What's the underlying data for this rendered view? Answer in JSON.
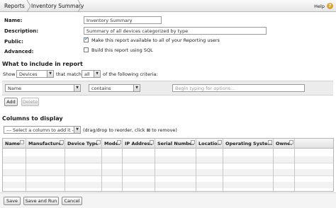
{
  "breadcrumb": {
    "root": "Reports",
    "current": "Inventory Summary"
  },
  "help": {
    "label": "Help"
  },
  "form": {
    "name_label": "Name:",
    "name_value": "Inventory Summary",
    "description_label": "Description:",
    "description_value": "Summary of all devices categorized by type",
    "public_label": "Public:",
    "public_text": "Make this report available to all of your Reporting users",
    "public_checked": true,
    "advanced_label": "Advanced:",
    "advanced_text": "Build this report using SQL",
    "advanced_checked": false
  },
  "criteria": {
    "section_title": "What to include in report",
    "show_label": "Show",
    "show_value": "Devices",
    "match_label": "that match",
    "match_value": "all",
    "criteria_suffix": "of the following criteria:",
    "field_value": "Name",
    "operator_value": "contains",
    "value_placeholder": "Begin typing for options...",
    "add_button": "Add",
    "delete_button": "Delete"
  },
  "columns": {
    "section_title": "Columns to display",
    "select_placeholder": "--- Select a column to add it ---",
    "hint": "(drag/drop to reorder, click ⊠ to remove)",
    "headers": [
      "Name",
      "Manufacturer",
      "Device Type",
      "Model",
      "IP Address",
      "Serial Number",
      "Location",
      "Operating System",
      "Owner"
    ]
  },
  "footer": {
    "save": "Save",
    "save_and_run": "Save and Run",
    "cancel": "Cancel"
  }
}
